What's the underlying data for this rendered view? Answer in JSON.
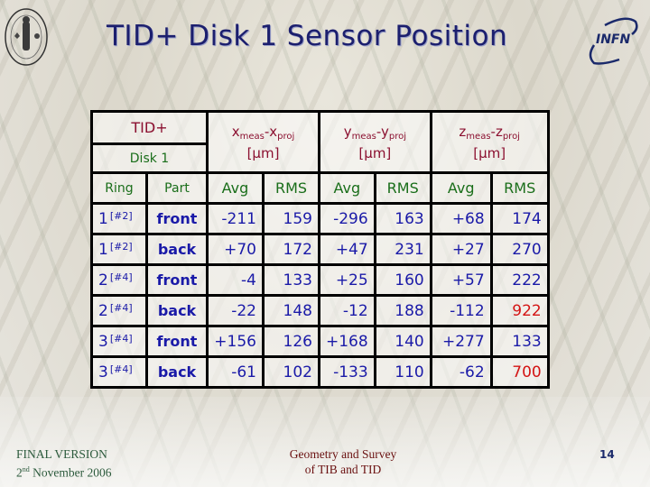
{
  "header": {
    "title": "TID+ Disk 1 Sensor Position",
    "logo_left": "university-seal",
    "logo_right": "INFN"
  },
  "table": {
    "corner_top": "TID+",
    "corner_bottom": "Disk 1",
    "groups": [
      {
        "main": "x",
        "sub1": "meas",
        "sep": "-",
        "main2": "x",
        "sub2": "proj",
        "unit": "[µm]"
      },
      {
        "main": "y",
        "sub1": "meas",
        "sep": "-",
        "main2": "y",
        "sub2": "proj",
        "unit": "[µm]"
      },
      {
        "main": "z",
        "sub1": "meas",
        "sep": "-",
        "main2": "z",
        "sub2": "proj",
        "unit": "[µm]"
      }
    ],
    "col_headers": [
      "Ring",
      "Part",
      "Avg",
      "RMS",
      "Avg",
      "RMS",
      "Avg",
      "RMS"
    ],
    "rows": [
      {
        "ring": "1",
        "ring_note": "[#2]",
        "part": "front",
        "x_avg": "-211",
        "x_rms": "159",
        "y_avg": "-296",
        "y_rms": "163",
        "z_avg": "+68",
        "z_rms": "174",
        "z_rms_highlight": false
      },
      {
        "ring": "1",
        "ring_note": "[#2]",
        "part": "back",
        "x_avg": "+70",
        "x_rms": "172",
        "y_avg": "+47",
        "y_rms": "231",
        "z_avg": "+27",
        "z_rms": "270",
        "z_rms_highlight": false
      },
      {
        "ring": "2",
        "ring_note": "[#4]",
        "part": "front",
        "x_avg": "-4",
        "x_rms": "133",
        "y_avg": "+25",
        "y_rms": "160",
        "z_avg": "+57",
        "z_rms": "222",
        "z_rms_highlight": false
      },
      {
        "ring": "2",
        "ring_note": "[#4]",
        "part": "back",
        "x_avg": "-22",
        "x_rms": "148",
        "y_avg": "-12",
        "y_rms": "188",
        "z_avg": "-112",
        "z_rms": "922",
        "z_rms_highlight": true
      },
      {
        "ring": "3",
        "ring_note": "[#4]",
        "part": "front",
        "x_avg": "+156",
        "x_rms": "126",
        "y_avg": "+168",
        "y_rms": "140",
        "z_avg": "+277",
        "z_rms": "133",
        "z_rms_highlight": false
      },
      {
        "ring": "3",
        "ring_note": "[#4]",
        "part": "back",
        "x_avg": "-61",
        "x_rms": "102",
        "y_avg": "-133",
        "y_rms": "110",
        "z_avg": "-62",
        "z_rms": "700",
        "z_rms_highlight": true
      }
    ],
    "colors": {
      "header_text": "#8b1030",
      "column_label": "#1a6e1a",
      "value": "#1a1aa8",
      "highlight": "#d41414"
    }
  },
  "footer": {
    "left_line1": "FINAL VERSION",
    "left_line2_prefix": "2",
    "left_line2_sup": "nd",
    "left_line2_rest": " November 2006",
    "center_line1": "Geometry and Survey",
    "center_line2": "of TIB and TID",
    "page_number": "14"
  }
}
